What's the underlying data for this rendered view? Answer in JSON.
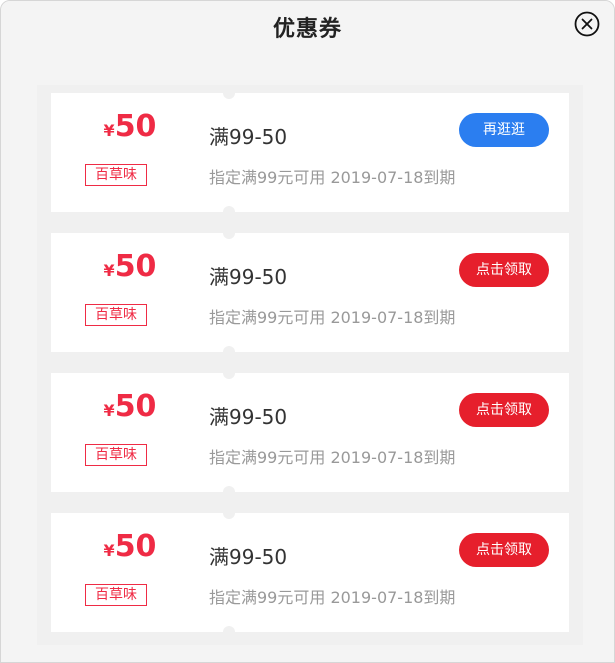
{
  "header": {
    "title": "优惠券",
    "close_icon": "close-circle-icon"
  },
  "colors": {
    "price": "#ef2b45",
    "blue_button": "#2b7ef0",
    "red_button": "#e61f2c"
  },
  "coupons": [
    {
      "currency": "¥",
      "amount": "50",
      "tag": "百草味",
      "title": "满99-50",
      "desc": "指定满99元可用 2019-07-18到期",
      "button": "再逛逛",
      "button_style": "blue"
    },
    {
      "currency": "¥",
      "amount": "50",
      "tag": "百草味",
      "title": "满99-50",
      "desc": "指定满99元可用 2019-07-18到期",
      "button": "点击领取",
      "button_style": "red"
    },
    {
      "currency": "¥",
      "amount": "50",
      "tag": "百草味",
      "title": "满99-50",
      "desc": "指定满99元可用 2019-07-18到期",
      "button": "点击领取",
      "button_style": "red"
    },
    {
      "currency": "¥",
      "amount": "50",
      "tag": "百草味",
      "title": "满99-50",
      "desc": "指定满99元可用 2019-07-18到期",
      "button": "点击领取",
      "button_style": "red"
    }
  ]
}
